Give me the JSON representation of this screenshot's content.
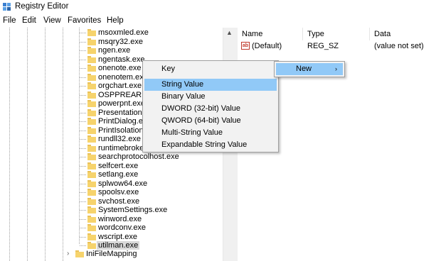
{
  "window": {
    "title": "Registry Editor",
    "icon": "registry-icon"
  },
  "menubar": {
    "items": [
      "File",
      "Edit",
      "View",
      "Favorites",
      "Help"
    ]
  },
  "tree": {
    "items": [
      "msoxmled.exe",
      "msqry32.exe",
      "ngen.exe",
      "ngentask.exe",
      "onenote.exe",
      "onenotem.exe",
      "orgchart.exe",
      "OSPPREARM.EXE",
      "powerpnt.exe",
      "Presentation",
      "PrintDialog.exe",
      "PrintIsolation",
      "rundll32.exe",
      "runtimebroker",
      "searchprotocolhost.exe",
      "selfcert.exe",
      "setlang.exe",
      "splwow64.exe",
      "spoolsv.exe",
      "svchost.exe",
      "SystemSettings.exe",
      "winword.exe",
      "wordconv.exe",
      "wscript.exe",
      "utilman.exe"
    ],
    "selected_index": 24,
    "sibling_label": "IniFileMapping"
  },
  "list": {
    "headers": [
      "Name",
      "Type",
      "Data"
    ],
    "rows": [
      {
        "name": "(Default)",
        "type": "REG_SZ",
        "data": "(value not set)",
        "icon": "ab-string-icon",
        "icon_text": "ab"
      }
    ]
  },
  "context_menu": {
    "items": [
      "Key",
      "String Value",
      "Binary Value",
      "DWORD (32-bit) Value",
      "QWORD (64-bit) Value",
      "Multi-String Value",
      "Expandable String Value"
    ],
    "highlighted_index": 1
  },
  "new_menu": {
    "label": "New",
    "arrow": "›"
  },
  "colors": {
    "highlight": "#91c9f7",
    "folder": "#f6d36c",
    "menu_bg": "#f2f2f2"
  }
}
